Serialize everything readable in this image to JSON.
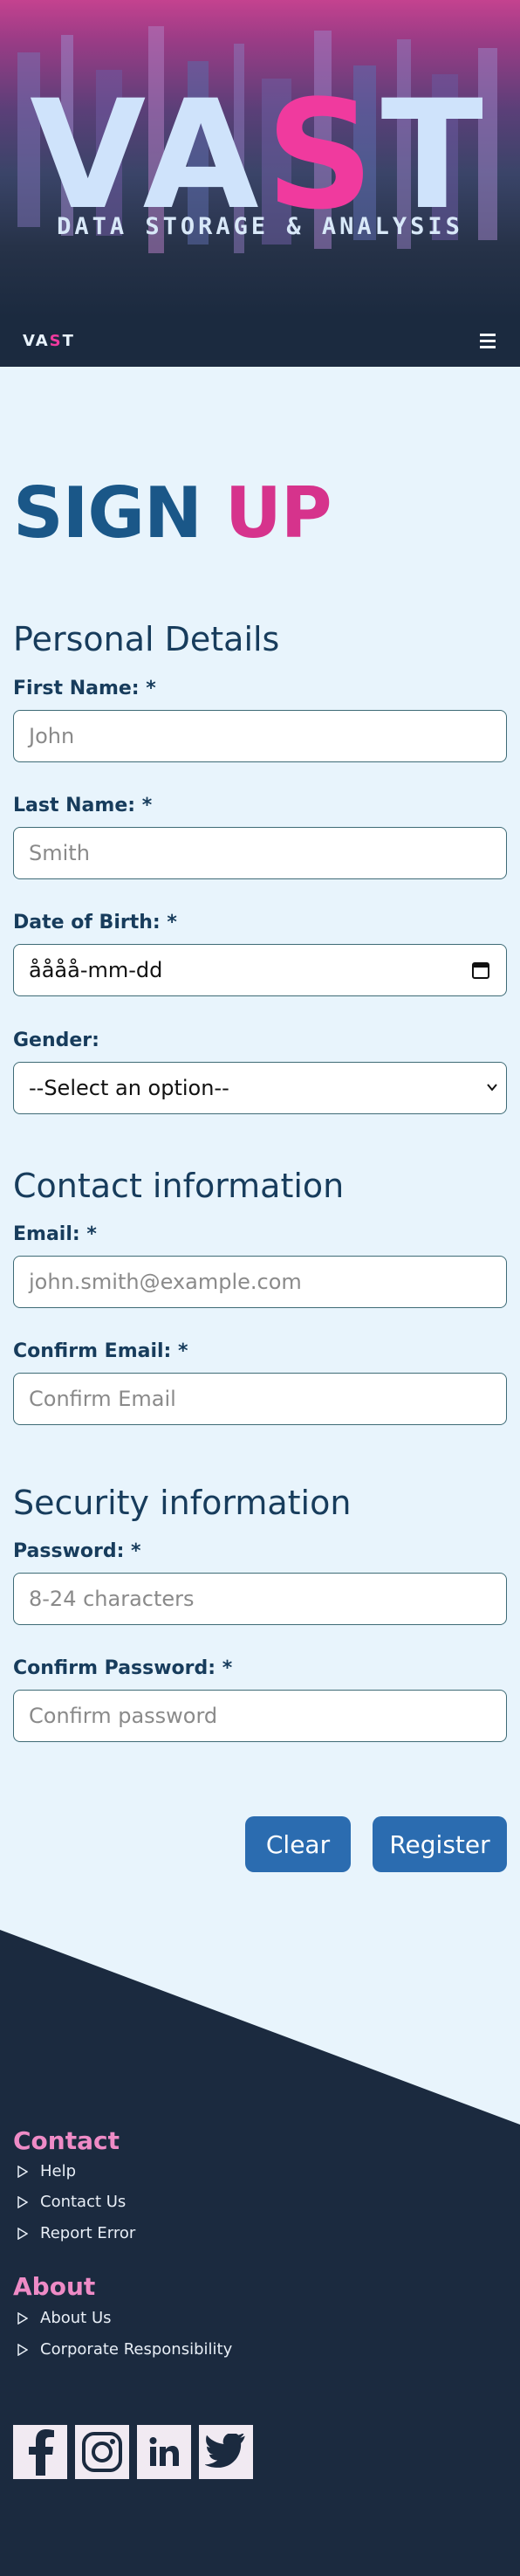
{
  "hero": {
    "logo_part1": "VA",
    "logo_accent": "S",
    "logo_part2": "T",
    "subtitle": "DATA STORAGE & ANALYSIS"
  },
  "navbar": {
    "logo_part1": "VA",
    "logo_accent": "S",
    "logo_part2": "T",
    "menu_icon": "hamburger-menu-icon"
  },
  "page": {
    "title_word1": "SIGN",
    "title_word2": "UP"
  },
  "form": {
    "personal_heading": "Personal Details",
    "first_name_label": "First Name: *",
    "first_name_placeholder": "John",
    "last_name_label": "Last Name: *",
    "last_name_placeholder": "Smith",
    "dob_label": "Date of Birth: *",
    "dob_value": "åååå-mm-dd",
    "gender_label": "Gender:",
    "gender_selected": "--Select an option--",
    "contact_heading": "Contact information",
    "email_label": "Email: *",
    "email_placeholder": "john.smith@example.com",
    "confirm_email_label": "Confirm Email: *",
    "confirm_email_placeholder": "Confirm Email",
    "security_heading": "Security information",
    "password_label": "Password: *",
    "password_placeholder": "8-24 characters",
    "confirm_password_label": "Confirm Password: *",
    "confirm_password_placeholder": "Confirm password",
    "clear_label": "Clear",
    "register_label": "Register"
  },
  "footer": {
    "contact_heading": "Contact",
    "contact_links": [
      "Help",
      "Contact Us",
      "Report Error"
    ],
    "about_heading": "About",
    "about_links": [
      "About Us",
      "Corporate Responsibility"
    ],
    "social_icons": [
      "facebook-icon",
      "instagram-icon",
      "linkedin-icon",
      "twitter-icon"
    ]
  },
  "colors": {
    "accent_pink": "#f03a9e",
    "title_blue": "#1a5788",
    "button_blue": "#2b6cb0",
    "footer_navy": "#1b2a3f",
    "footer_heading_pink": "#ee8bc6",
    "page_background": "#e8f4fc"
  }
}
